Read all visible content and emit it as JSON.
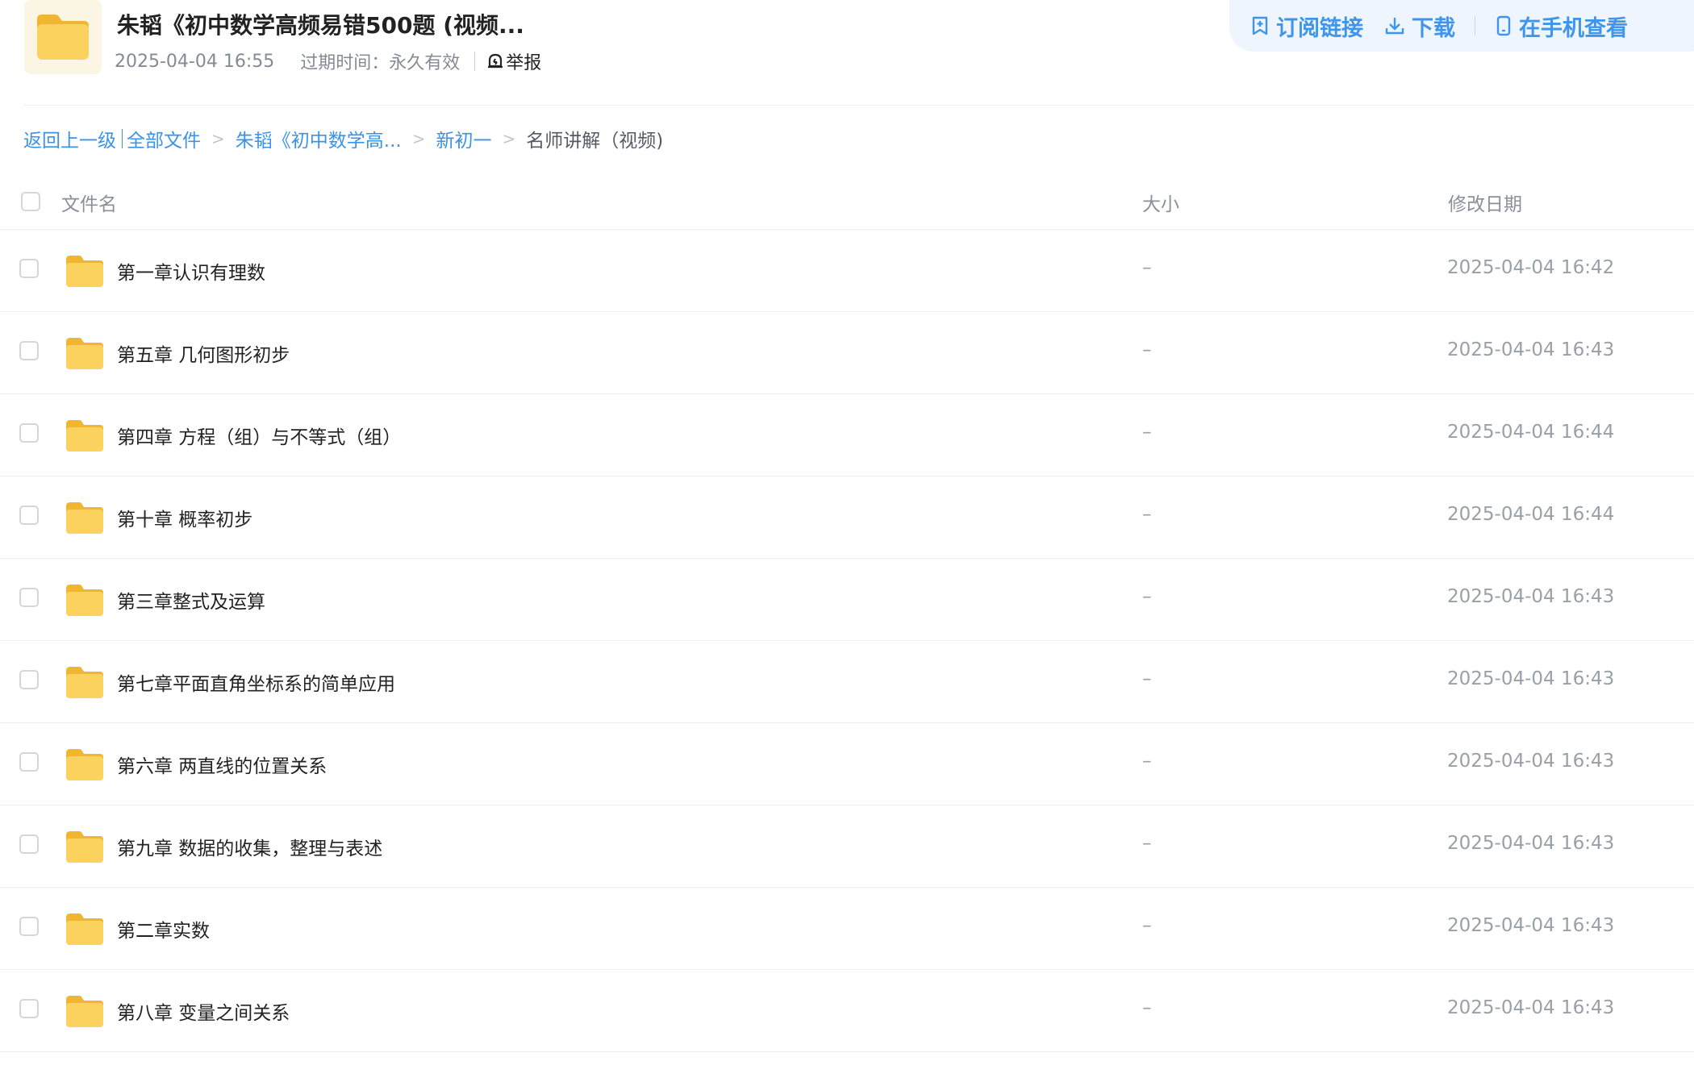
{
  "header": {
    "title": "朱韬《初中数学高频易错500题 (视频...",
    "date": "2025-04-04 16:55",
    "expire_label": "过期时间：",
    "expire_value": "永久有效",
    "report_label": "举报",
    "folder_icon": "folder-icon",
    "report_icon": "report-bell-icon"
  },
  "actions": {
    "subscribe_label": "订阅链接",
    "download_label": "下载",
    "phone_label": "在手机查看",
    "subscribe_icon": "subscribe-icon",
    "download_icon": "download-icon",
    "phone_icon": "phone-icon"
  },
  "breadcrumb": {
    "back": "返回上一级",
    "all": "全部文件",
    "sep": ">",
    "level1": "朱韬《初中数学高...",
    "level2": "新初一",
    "current": "名师讲解（视频)"
  },
  "table": {
    "col_name": "文件名",
    "col_size": "大小",
    "col_date": "修改日期",
    "rows": [
      {
        "name": "第一章认识有理数",
        "size": "–",
        "date": "2025-04-04 16:42"
      },
      {
        "name": "第五章 几何图形初步",
        "size": "–",
        "date": "2025-04-04 16:43"
      },
      {
        "name": "第四章 方程（组）与不等式（组）",
        "size": "–",
        "date": "2025-04-04 16:44"
      },
      {
        "name": "第十章 概率初步",
        "size": "–",
        "date": "2025-04-04 16:44"
      },
      {
        "name": "第三章整式及运算",
        "size": "–",
        "date": "2025-04-04 16:43"
      },
      {
        "name": "第七章平面直角坐标系的简单应用",
        "size": "–",
        "date": "2025-04-04 16:43"
      },
      {
        "name": "第六章 两直线的位置关系",
        "size": "–",
        "date": "2025-04-04 16:43"
      },
      {
        "name": "第九章 数据的收集，整理与表述",
        "size": "–",
        "date": "2025-04-04 16:43"
      },
      {
        "name": "第二章实数",
        "size": "–",
        "date": "2025-04-04 16:43"
      },
      {
        "name": "第八章 变量之间关系",
        "size": "–",
        "date": "2025-04-04 16:43"
      }
    ]
  },
  "colors": {
    "accent": "#3f95ec",
    "folder": "#f7c948",
    "action_bg": "#eef5fd"
  }
}
